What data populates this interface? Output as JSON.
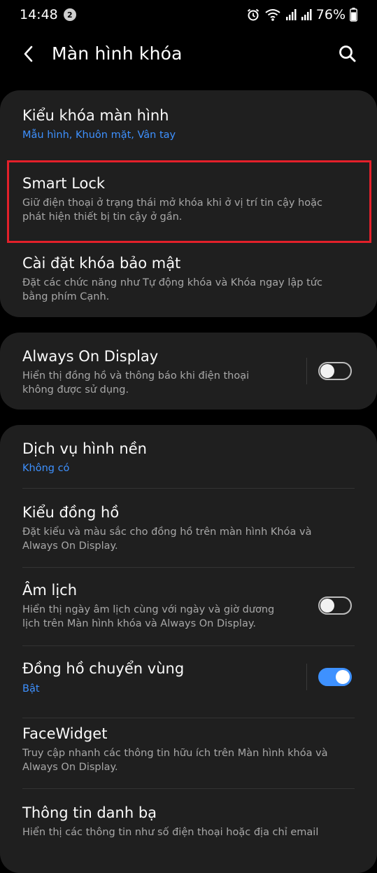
{
  "status_bar": {
    "time": "14:48",
    "notification_count": "2",
    "battery": "76%"
  },
  "header": {
    "title": "Màn hình khóa",
    "back_icon": "chevron-left-icon",
    "search_icon": "search-icon"
  },
  "groups": [
    {
      "items": [
        {
          "title": "Kiểu khóa màn hình",
          "subtitle": "Mẫu hình, Khuôn mặt, Vân tay"
        },
        {
          "title": "Smart Lock",
          "subtitle": "Giữ điện thoại ở trạng thái mở khóa khi ở vị trí tin cậy hoặc phát hiện thiết bị tin cậy ở gần."
        },
        {
          "title": "Cài đặt khóa bảo mật",
          "subtitle": "Đặt các chức năng như Tự động khóa và Khóa ngay lập tức bằng phím Cạnh."
        }
      ]
    },
    {
      "items": [
        {
          "title": "Always On Display",
          "subtitle": "Hiển thị đồng hồ và thông báo khi điện thoại không được sử dụng.",
          "toggle_on": false
        }
      ]
    },
    {
      "items": [
        {
          "title": "Dịch vụ hình nền",
          "subtitle": "Không có"
        },
        {
          "title": "Kiểu đồng hồ",
          "subtitle": "Đặt kiểu và màu sắc cho đồng hồ trên màn hình Khóa và Always On Display."
        },
        {
          "title": "Âm lịch",
          "subtitle": "Hiển thị ngày âm lịch cùng với ngày và giờ dương lịch trên Màn hình khóa và Always On Display.",
          "toggle_on": false
        },
        {
          "title": "Đồng hồ chuyển vùng",
          "subtitle": "Bật",
          "toggle_on": true
        },
        {
          "title": "FaceWidget",
          "subtitle": "Truy cập nhanh các thông tin hữu ích trên Màn hình khóa và Always On Display."
        },
        {
          "title": "Thông tin danh bạ",
          "subtitle": "Hiển thị các thông tin như số điện thoại hoặc địa chỉ email"
        }
      ]
    }
  ],
  "colors": {
    "background": "#000000",
    "card": "#1f1f1f",
    "accent": "#3e91ff",
    "highlight": "#e3202a"
  }
}
